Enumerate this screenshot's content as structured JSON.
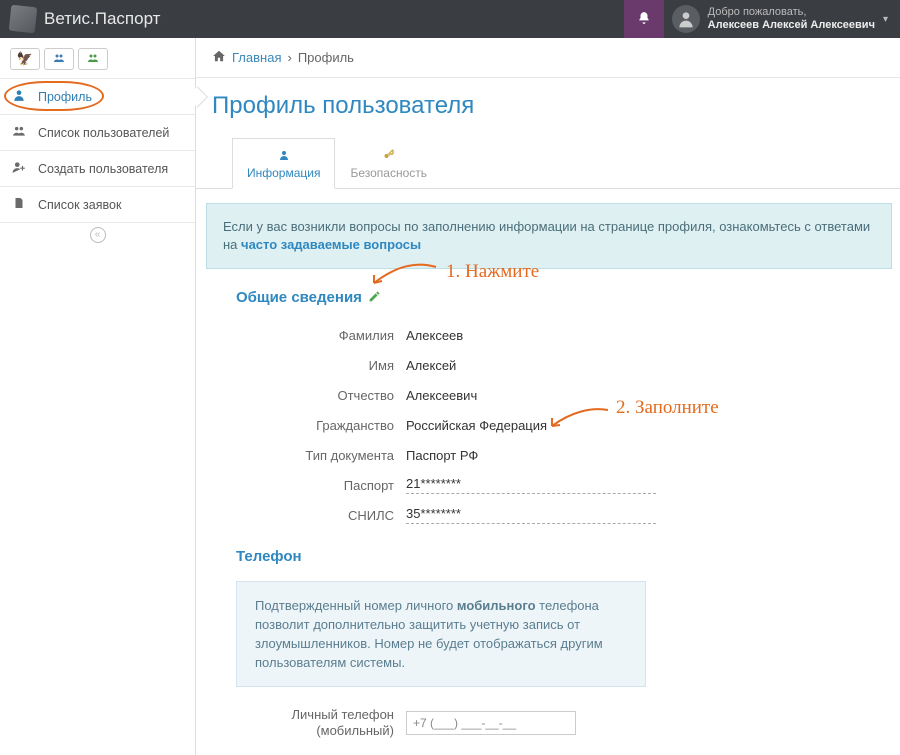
{
  "app": {
    "name": "Ветис.Паспорт"
  },
  "header": {
    "welcome": "Добро пожаловать,",
    "user": "Алексеев Алексей Алексеевич"
  },
  "sidebar": {
    "items": [
      {
        "label": "Профиль"
      },
      {
        "label": "Список пользователей"
      },
      {
        "label": "Создать пользователя"
      },
      {
        "label": "Список заявок"
      }
    ]
  },
  "breadcrumb": {
    "home": "Главная",
    "current": "Профиль"
  },
  "page": {
    "title": "Профиль пользователя"
  },
  "tabs": {
    "info": "Информация",
    "security": "Безопасность"
  },
  "notice": {
    "text": "Если у вас возникли вопросы по заполнению информации на странице профиля, ознакомьтесь с ответами на ",
    "link": "часто задаваемые вопросы"
  },
  "section": {
    "general_title": "Общие сведения",
    "fields": {
      "lastname_label": "Фамилия",
      "lastname_value": "Алексеев",
      "firstname_label": "Имя",
      "firstname_value": "Алексей",
      "patronymic_label": "Отчество",
      "patronymic_value": "Алексеевич",
      "citizenship_label": "Гражданство",
      "citizenship_value": "Российская Федерация",
      "doctype_label": "Тип документа",
      "doctype_value": "Паспорт РФ",
      "passport_label": "Паспорт",
      "passport_value": "21********",
      "snils_label": "СНИЛС",
      "snils_value": "35********"
    },
    "phone_title": "Телефон",
    "phone_note": "Подтвержденный номер личного мобильного телефона позволит дополнительно защитить учетную запись от злоумышленников. Номер не будет отображаться другим пользователям системы.",
    "phone_note_bold": "мобильного",
    "phone_label": "Личный телефон (мобильный)",
    "phone_value": "+7 (___) ___-__-__"
  },
  "annotations": {
    "a1": "1. Нажмите",
    "a2": "2. Заполните"
  }
}
